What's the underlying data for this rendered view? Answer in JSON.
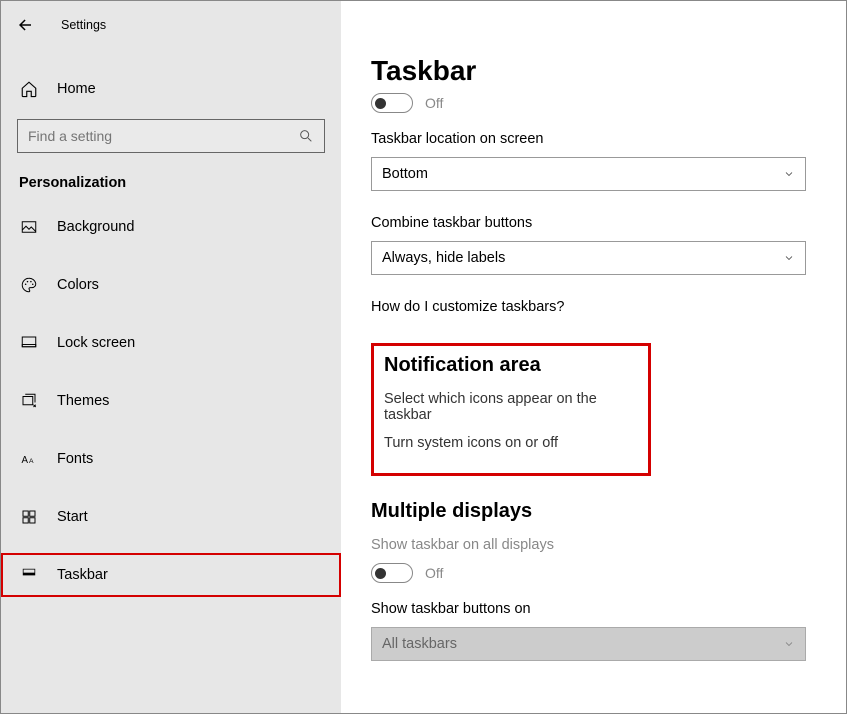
{
  "titlebar": {
    "title": "Settings"
  },
  "sidebar": {
    "home": "Home",
    "search_placeholder": "Find a setting",
    "group": "Personalization",
    "items": [
      {
        "label": "Background"
      },
      {
        "label": "Colors"
      },
      {
        "label": "Lock screen"
      },
      {
        "label": "Themes"
      },
      {
        "label": "Fonts"
      },
      {
        "label": "Start"
      },
      {
        "label": "Taskbar"
      }
    ]
  },
  "main": {
    "title": "Taskbar",
    "toggle_off": "Off",
    "location_label": "Taskbar location on screen",
    "location_value": "Bottom",
    "combine_label": "Combine taskbar buttons",
    "combine_value": "Always, hide labels",
    "help_link": "How do I customize taskbars?",
    "notif_section": "Notification area",
    "notif_link1": "Select which icons appear on the taskbar",
    "notif_link2": "Turn system icons on or off",
    "multi_section": "Multiple displays",
    "multi_toggle_label": "Show taskbar on all displays",
    "multi_toggle_state": "Off",
    "buttons_label": "Show taskbar buttons on",
    "buttons_value": "All taskbars"
  }
}
